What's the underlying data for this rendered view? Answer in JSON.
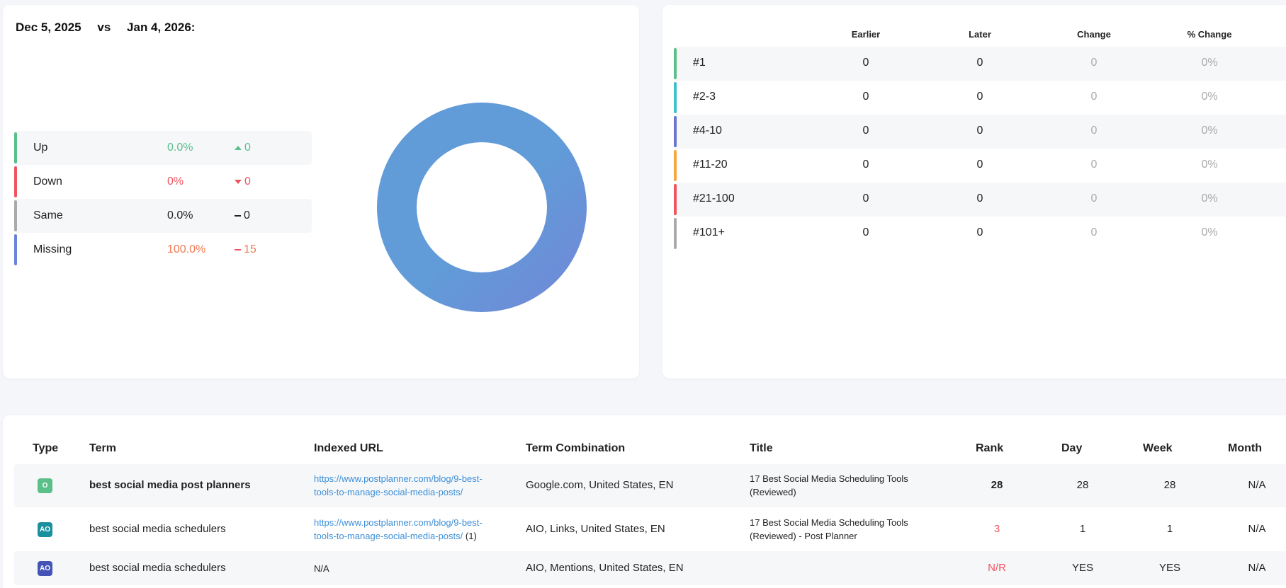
{
  "comparison": {
    "date_earlier": "Dec 5, 2025",
    "vs": "vs",
    "date_later": "Jan 4, 2026:"
  },
  "movement_legend": [
    {
      "label": "Up",
      "pct": "0.0%",
      "delta": "0",
      "color": "#5bbf8a",
      "delta_icon": "triangle-up-icon"
    },
    {
      "label": "Down",
      "pct": "0%",
      "delta": "0",
      "color": "#f0555f",
      "delta_icon": "triangle-down-icon"
    },
    {
      "label": "Same",
      "pct": "0.0%",
      "delta": "0",
      "color": "#aaaaaa",
      "delta_icon": "dash-icon"
    },
    {
      "label": "Missing",
      "pct": "100.0%",
      "delta": "15",
      "color": "#6a85d8",
      "delta_icon": "dash-icon"
    }
  ],
  "chart_data": {
    "type": "pie",
    "categories": [
      "Up",
      "Down",
      "Same",
      "Missing"
    ],
    "values": [
      0,
      0,
      0,
      100
    ],
    "donut": true,
    "colors": [
      "#5bbf8a",
      "#f0555f",
      "#aaaaaa",
      "#6199d8"
    ]
  },
  "rank_table": {
    "headers": [
      "Earlier",
      "Later",
      "Change",
      "% Change"
    ],
    "rows": [
      {
        "label": "#1",
        "earlier": "0",
        "later": "0",
        "change": "0",
        "pct": "0%",
        "color": "#5bbf8a"
      },
      {
        "label": "#2-3",
        "earlier": "0",
        "later": "0",
        "change": "0",
        "pct": "0%",
        "color": "#3fc1c9"
      },
      {
        "label": "#4-10",
        "earlier": "0",
        "later": "0",
        "change": "0",
        "pct": "0%",
        "color": "#6a75d0"
      },
      {
        "label": "#11-20",
        "earlier": "0",
        "later": "0",
        "change": "0",
        "pct": "0%",
        "color": "#f5a742"
      },
      {
        "label": "#21-100",
        "earlier": "0",
        "later": "0",
        "change": "0",
        "pct": "0%",
        "color": "#f0555f"
      },
      {
        "label": "#101+",
        "earlier": "0",
        "later": "0",
        "change": "0",
        "pct": "0%",
        "color": "#aaaaaa"
      }
    ]
  },
  "terms_table": {
    "headers": {
      "type": "Type",
      "term": "Term",
      "url": "Indexed URL",
      "combo": "Term Combination",
      "title": "Title",
      "rank": "Rank",
      "day": "Day",
      "week": "Week",
      "month": "Month"
    },
    "rows": [
      {
        "type_badge": "O",
        "type_color": "#5bbf8a",
        "term": "best social media post planners",
        "url_line1": "https://www.postplanner.com/blog/9-best-",
        "url_line2": "tools-to-manage-social-media-posts/",
        "url_count": "",
        "combo": "Google.com, United States, EN",
        "title_line1": "17 Best Social Media Scheduling Tools",
        "title_line2": "(Reviewed)",
        "rank": "28",
        "day": "28",
        "week": "28",
        "month": "N/A"
      },
      {
        "type_badge": "AO",
        "type_color": "#1a8f9e",
        "term": "best social media schedulers",
        "url_line1": "https://www.postplanner.com/blog/9-best-",
        "url_line2": "tools-to-manage-social-media-posts/",
        "url_count": "(1)",
        "combo": "AIO, Links, United States, EN",
        "title_line1": "17 Best Social Media Scheduling Tools",
        "title_line2": "(Reviewed) - Post Planner",
        "rank": "3",
        "day": "1",
        "week": "1",
        "month": "N/A"
      },
      {
        "type_badge": "AO",
        "type_color": "#4453b5",
        "term": "best social media schedulers",
        "url_line1": "N/A",
        "url_line2": "",
        "url_count": "",
        "combo": "AIO, Mentions, United States, EN",
        "title_line1": "",
        "title_line2": "",
        "rank": "N/R",
        "day": "YES",
        "week": "YES",
        "month": "N/A"
      }
    ]
  }
}
